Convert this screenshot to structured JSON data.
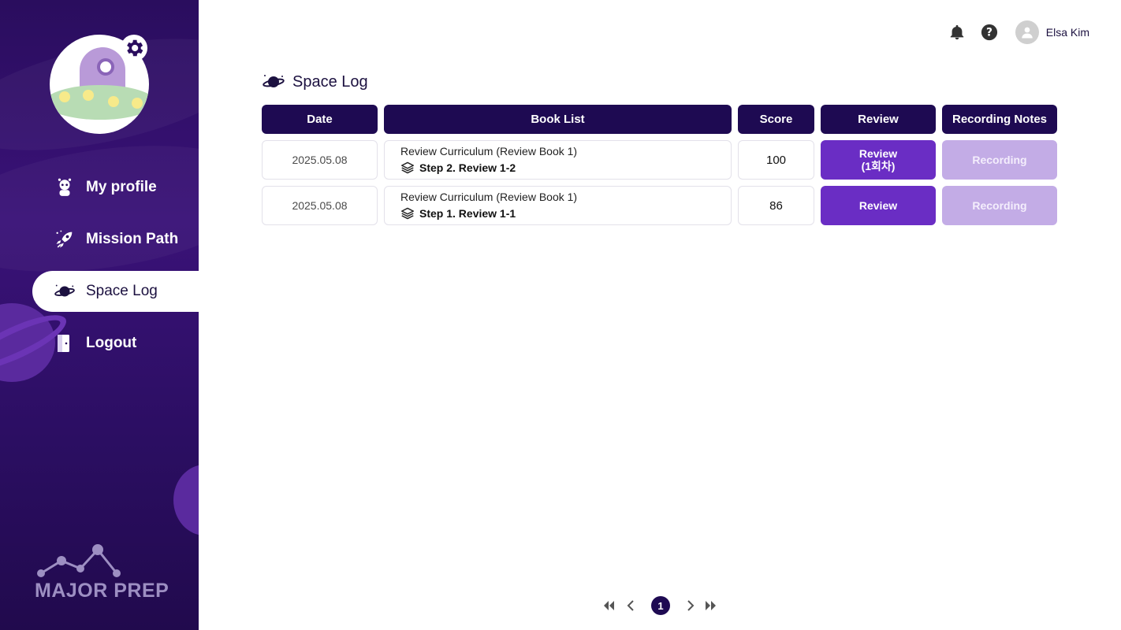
{
  "sidebar": {
    "items": [
      {
        "label": "My profile",
        "icon": "alien-icon"
      },
      {
        "label": "Mission Path",
        "icon": "rocket-icon"
      },
      {
        "label": "Space Log",
        "icon": "planet-icon",
        "active": true
      },
      {
        "label": "Logout",
        "icon": "door-icon"
      }
    ],
    "brand": "MAJOR PREP"
  },
  "header": {
    "user_name": "Elsa Kim",
    "icons": [
      "bell-icon",
      "help-icon",
      "user-avatar-icon"
    ]
  },
  "main": {
    "title": "Space Log",
    "table": {
      "columns": [
        "Date",
        "Book List",
        "Score",
        "Review",
        "Recording Notes"
      ],
      "rows": [
        {
          "date": "2025.05.08",
          "book": "Review Curriculum (Review Book 1)",
          "step": "Step 2. Review 1-2",
          "score": "100",
          "review_label": "Review",
          "review_sub": "(1회차)",
          "recording_label": "Recording"
        },
        {
          "date": "2025.05.08",
          "book": "Review Curriculum (Review Book 1)",
          "step": "Step 1. Review 1-1",
          "score": "86",
          "review_label": "Review",
          "review_sub": "",
          "recording_label": "Recording"
        }
      ]
    }
  },
  "pagination": {
    "current_page": "1"
  },
  "colors": {
    "sidebar_bg": "#2a0d5e",
    "header_cell": "#1e0a52",
    "review_button": "#6a2dc4",
    "recording_button": "#c3ace6"
  }
}
